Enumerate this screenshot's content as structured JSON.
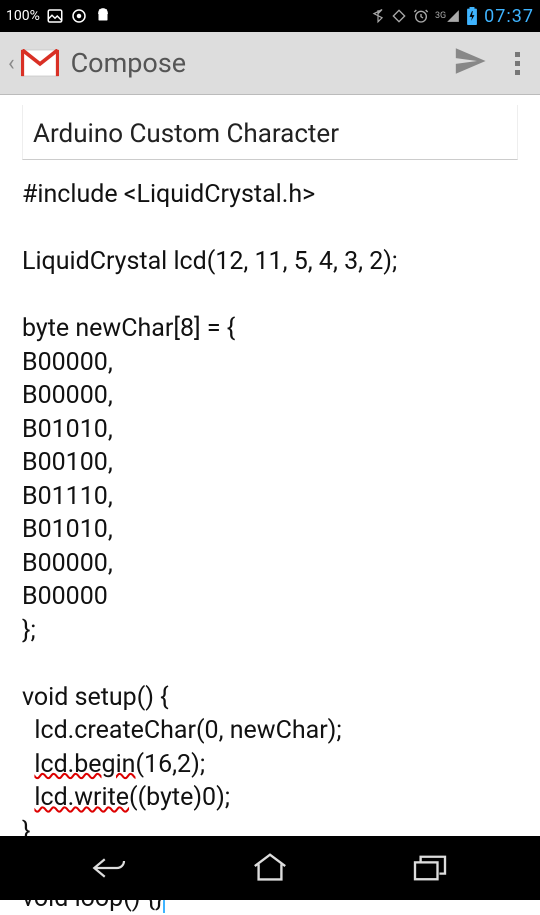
{
  "status_bar": {
    "battery_pct": "100%",
    "clock": "07:37",
    "network": "3G"
  },
  "app_bar": {
    "title": "Compose"
  },
  "compose": {
    "subject": "Arduino Custom Character",
    "body_include": "#include <LiquidCrystal.h>",
    "body_lcd_init": "LiquidCrystal lcd(12, 11, 5, 4, 3, 2);",
    "body_byte_decl": "byte newChar[8] = {",
    "body_b0": "B00000,",
    "body_b1": "B00000,",
    "body_b2": "B01010,",
    "body_b3": "B00100,",
    "body_b4": "B01110,",
    "body_b5": "B01010,",
    "body_b6": "B00000,",
    "body_b7": "B00000",
    "body_byte_close": "};",
    "body_setup_open": "void setup() {",
    "body_createchar": "  lcd.createChar(0, newChar);",
    "body_begin_pre": "  ",
    "body_begin_err": "lcd.begin",
    "body_begin_post": "(16,2);",
    "body_write_pre": "  ",
    "body_write_err": "lcd.write",
    "body_write_post": "((byte)0);",
    "body_setup_close": "}",
    "body_loop": "void loop() {}"
  }
}
